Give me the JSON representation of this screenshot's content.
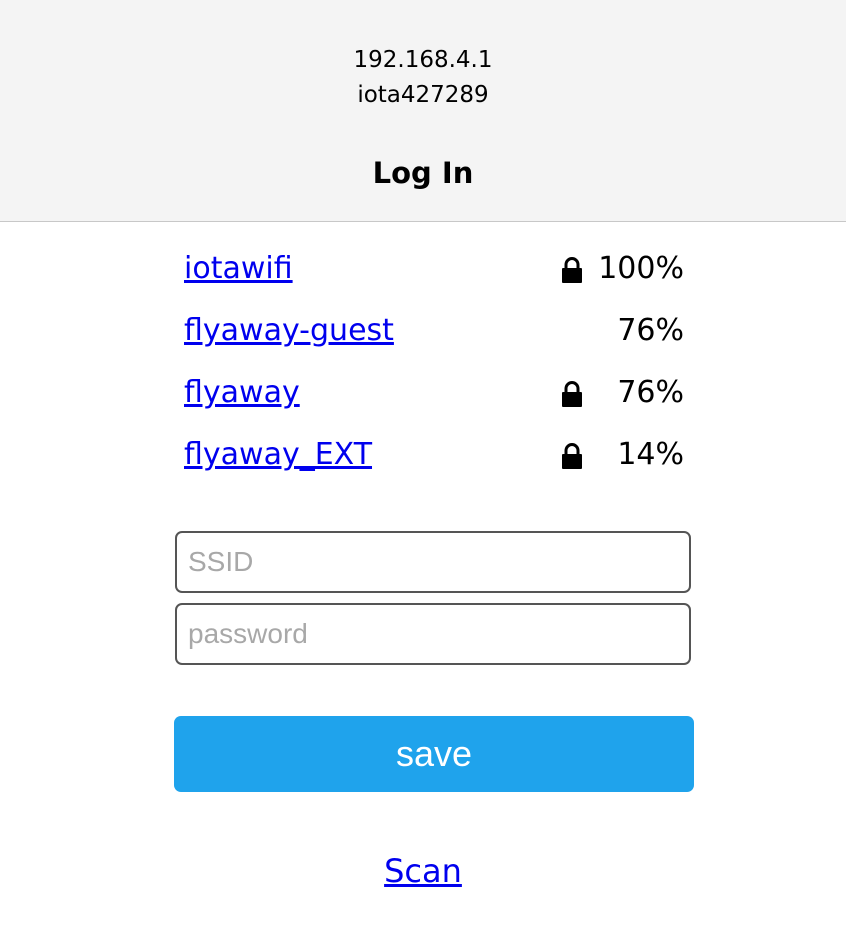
{
  "header": {
    "ip": "192.168.4.1",
    "hostname": "iota427289",
    "title": "Log In"
  },
  "networks": [
    {
      "ssid": "iotawifi",
      "secured": true,
      "signal": "100%"
    },
    {
      "ssid": "flyaway-guest",
      "secured": false,
      "signal": "76%"
    },
    {
      "ssid": "flyaway",
      "secured": true,
      "signal": "76%"
    },
    {
      "ssid": "flyaway_EXT",
      "secured": true,
      "signal": "14%"
    }
  ],
  "form": {
    "ssid_placeholder": "SSID",
    "ssid_value": "",
    "password_placeholder": "password",
    "password_value": "",
    "save_label": "save"
  },
  "scan_label": "Scan",
  "colors": {
    "link": "#0000ee",
    "button": "#1fa3ec",
    "header_bg": "#f4f4f4"
  },
  "icons": {
    "lock": "lock-icon"
  }
}
